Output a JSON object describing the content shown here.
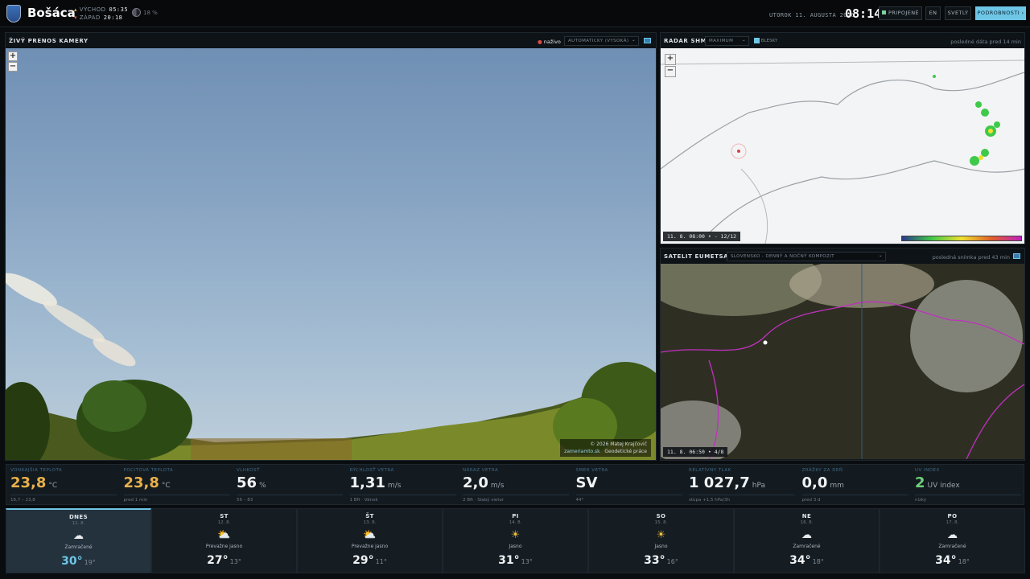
{
  "header": {
    "town": "Bošáca",
    "sunrise_label": "VÝCHOD",
    "sunrise": "05:35",
    "sunset_label": "ZÁPAD",
    "sunset": "20:18",
    "moon": "18 %",
    "date": "UTOROK 11. AUGUSTA 2026",
    "time": "08:14",
    "connected": "PRIPOJENÉ",
    "lang": "EN",
    "theme": "SVETLÝ",
    "details": "PODROBNOSTI ›"
  },
  "camera": {
    "title": "ŽIVÝ PRENOS KAMERY",
    "live": "naživo",
    "quality": "AUTOMATICKY (VYSOKÁ)",
    "zoom_in": "+",
    "zoom_out": "−",
    "credit1": "© 2026 Matej Krajčovič",
    "credit2a": "zameriamto.sk",
    "credit2b": "Geodetické práce"
  },
  "radar": {
    "title": "RADAR SHMÚ",
    "mode": "MAXIMUM",
    "lightning": "BLESKY",
    "note": "posledné dáta pred 14 min",
    "stamp": "11. 8. 08:00 • - 12/12",
    "zoom_in": "+",
    "zoom_out": "−"
  },
  "satellite": {
    "title": "SATELIT EUMETSAT",
    "mode": "SLOVENSKO - DENNÝ A NOČNÝ KOMPOZIT",
    "note": "posledná snímka pred 43 min",
    "stamp": "11. 8. 06:50 • 4/8"
  },
  "stats": [
    {
      "label": "VONKAJŠIA TEPLOTA",
      "value": "23,8",
      "unit": "°C",
      "sub": "16,7 – 23,8",
      "color": "#e8b04a"
    },
    {
      "label": "POCITOVÁ TEPLOTA",
      "value": "23,8",
      "unit": "°C",
      "sub": "pred 1 min",
      "color": "#e8b04a"
    },
    {
      "label": "VLHKOSŤ",
      "value": "56",
      "unit": "%",
      "sub": "56 – 83",
      "color": "#f0f3f5"
    },
    {
      "label": "RÝCHLOSŤ VETRA",
      "value": "1,31",
      "unit": "m/s",
      "sub": "1 Bft · Vánok",
      "color": "#f0f3f5"
    },
    {
      "label": "NÁRAZ VETRA",
      "value": "2,0",
      "unit": "m/s",
      "sub": "2 Bft · Slabý vietor",
      "color": "#f0f3f5"
    },
    {
      "label": "SMER VETRA",
      "value": "SV",
      "unit": "",
      "sub": "44°",
      "color": "#f0f3f5"
    },
    {
      "label": "RELATÍVNY TLAK",
      "value": "1 027,7",
      "unit": "hPa",
      "sub": "stúpa +1,5 hPa/3h",
      "color": "#f0f3f5"
    },
    {
      "label": "ZRÁŽKY ZA DEŇ",
      "value": "0,0",
      "unit": "mm",
      "sub": "pred 3 d",
      "color": "#f0f3f5"
    },
    {
      "label": "UV INDEX",
      "value": "2",
      "unit": "UV index",
      "sub": "nízky",
      "color": "#6fd07a"
    }
  ],
  "forecast": [
    {
      "day": "DNES",
      "date": "11. 8.",
      "icon": "cloud-icon",
      "glyph": "☁",
      "desc": "Zamračené",
      "hi": "30°",
      "lo": "19°",
      "hi_color": "#6ec6e6"
    },
    {
      "day": "ST",
      "date": "12. 8.",
      "icon": "partly-sunny-icon",
      "glyph": "⛅",
      "desc": "Prevažne jasno",
      "hi": "27°",
      "lo": "13°",
      "hi_color": "#f0f3f5"
    },
    {
      "day": "ŠT",
      "date": "13. 8.",
      "icon": "partly-sunny-icon",
      "glyph": "⛅",
      "desc": "Prevažne jasno",
      "hi": "29°",
      "lo": "11°",
      "hi_color": "#f0f3f5"
    },
    {
      "day": "PI",
      "date": "14. 8.",
      "icon": "sun-icon",
      "glyph": "☀",
      "desc": "Jasno",
      "hi": "31°",
      "lo": "13°",
      "hi_color": "#f0f3f5"
    },
    {
      "day": "SO",
      "date": "15. 8.",
      "icon": "sun-icon",
      "glyph": "☀",
      "desc": "Jasno",
      "hi": "33°",
      "lo": "16°",
      "hi_color": "#f0f3f5"
    },
    {
      "day": "NE",
      "date": "16. 8.",
      "icon": "cloud-icon",
      "glyph": "☁",
      "desc": "Zamračené",
      "hi": "34°",
      "lo": "18°",
      "hi_color": "#f0f3f5"
    },
    {
      "day": "PO",
      "date": "17. 8.",
      "icon": "cloud-icon",
      "glyph": "☁",
      "desc": "Zamračené",
      "hi": "34°",
      "lo": "18°",
      "hi_color": "#f0f3f5"
    }
  ]
}
